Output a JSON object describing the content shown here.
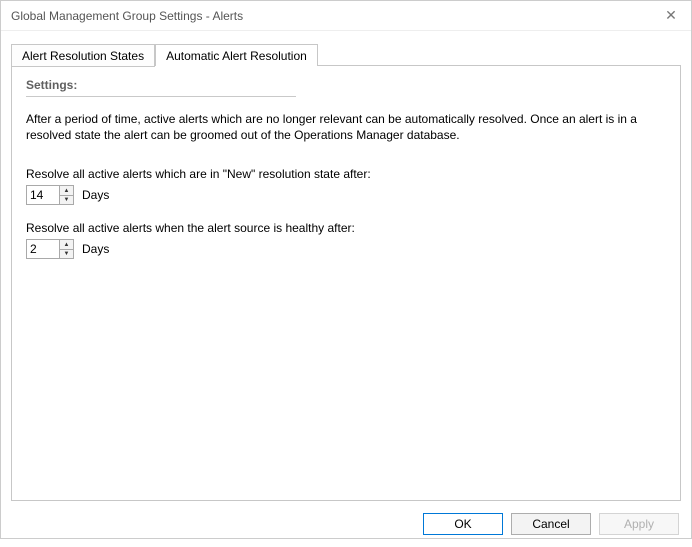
{
  "window": {
    "title": "Global Management Group Settings - Alerts"
  },
  "tabs": {
    "tab1": "Alert Resolution States",
    "tab2": "Automatic Alert Resolution"
  },
  "panel": {
    "section_title": "Settings:",
    "description": "After a period of time, active alerts which are no longer relevant can be automatically resolved. Once an alert is in a resolved state the alert can be groomed out of the Operations Manager database.",
    "field1": {
      "label": "Resolve all active alerts which are in \"New\" resolution state after:",
      "value": "14",
      "unit": "Days"
    },
    "field2": {
      "label": "Resolve all active alerts when the alert source is healthy after:",
      "value": "2",
      "unit": "Days"
    }
  },
  "buttons": {
    "ok": "OK",
    "cancel": "Cancel",
    "apply": "Apply"
  }
}
